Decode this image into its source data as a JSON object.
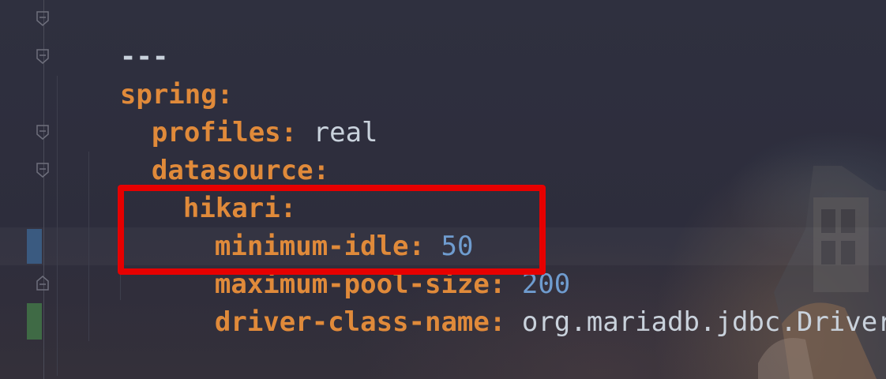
{
  "editor": {
    "language": "yaml",
    "lines": [
      {
        "doc_start": "---"
      },
      {
        "key": "spring",
        "colon": ":"
      },
      {
        "key": "profiles",
        "colon": ":",
        "value": "real"
      },
      {
        "key": "datasource",
        "colon": ":"
      },
      {
        "key": "hikari",
        "colon": ":"
      },
      {
        "key": "minimum-idle",
        "colon": ":",
        "value": "50"
      },
      {
        "key": "maximum-pool-size",
        "colon": ":",
        "value": "200"
      },
      {
        "key": "driver-class-name",
        "colon": ":",
        "value": "org.mariadb.jdbc.Driver"
      }
    ]
  },
  "colors": {
    "background": "#2e2f3f",
    "key": "#e08a3a",
    "string_value": "#c9d2dc",
    "number_value": "#6f9ccf",
    "highlight_border": "#e60000",
    "gutter_modified": "#3a5a80",
    "gutter_added": "#3f6a45"
  },
  "annotations": {
    "highlight_box": "minimum-idle and maximum-pool-size lines"
  },
  "icons": [
    "fold-marker-icon"
  ]
}
